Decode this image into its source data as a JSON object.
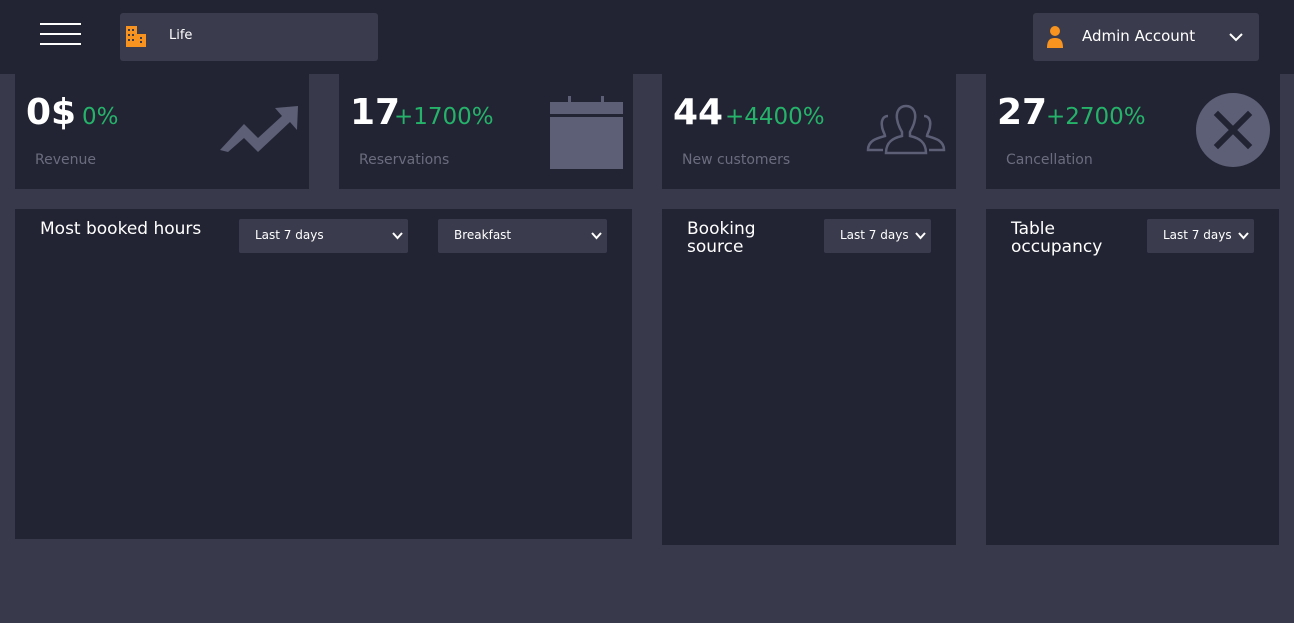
{
  "header": {
    "venue": {
      "label": "Life",
      "icon": "building-icon"
    },
    "account": {
      "label": "Admin Account",
      "icon": "user-icon"
    },
    "accent_color": "#f7931e"
  },
  "stats": [
    {
      "value": "0$",
      "change": "0%",
      "label": "Revenue",
      "icon": "trending-up-icon"
    },
    {
      "value": "17",
      "change": "+1700%",
      "label": "Reservations",
      "icon": "calendar-icon"
    },
    {
      "value": "44",
      "change": "+4400%",
      "label": "New customers",
      "icon": "users-icon"
    },
    {
      "value": "27",
      "change": "+2700%",
      "label": "Cancellation",
      "icon": "close-circle-icon"
    }
  ],
  "panels": {
    "booked_hours": {
      "title": "Most booked hours",
      "range": "Last 7 days",
      "meal": "Breakfast"
    },
    "booking_source": {
      "title_line1": "Booking",
      "title_line2": "source",
      "range": "Last 7 days"
    },
    "table_occupancy": {
      "title_line1": "Table",
      "title_line2": "occupancy",
      "range": "Last 7 days"
    }
  },
  "colors": {
    "background": "#383a4b",
    "card": "#222434",
    "control": "#3a3c4d",
    "positive": "#25b36a",
    "muted_icon": "#5d5f76"
  }
}
